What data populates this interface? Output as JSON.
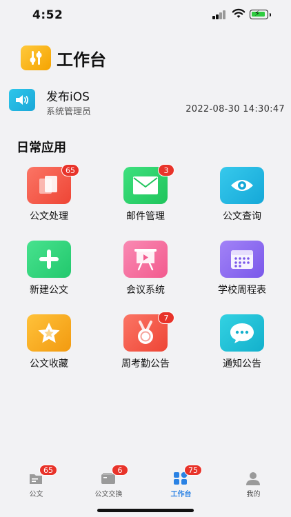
{
  "status_bar": {
    "time": "4:52"
  },
  "header": {
    "title": "工作台",
    "logo_icon": "sliders-icon"
  },
  "notice": {
    "icon": "speaker-icon",
    "title": "发布iOS",
    "sender": "系统管理员",
    "datetime": "2022-08-30 14:30:47"
  },
  "section": {
    "title": "日常应用"
  },
  "apps": [
    {
      "label": "公文处理",
      "icon": "documents-icon",
      "badge": "65",
      "color": "#f25a4a"
    },
    {
      "label": "邮件管理",
      "icon": "envelope-icon",
      "badge": "3",
      "color": "#2bd46a"
    },
    {
      "label": "公文查询",
      "icon": "eye-icon",
      "badge": "",
      "color": "#1fb5de"
    },
    {
      "label": "新建公文",
      "icon": "plus-icon",
      "badge": "",
      "color": "#2ed37a"
    },
    {
      "label": "会议系统",
      "icon": "presentation-icon",
      "badge": "",
      "color": "#f46a9c"
    },
    {
      "label": "学校周程表",
      "icon": "calendar-icon",
      "badge": "",
      "color": "#8a6cf0"
    },
    {
      "label": "公文收藏",
      "icon": "star-icon",
      "badge": "",
      "color": "#f5a81c"
    },
    {
      "label": "周考勤公告",
      "icon": "medal-icon",
      "badge": "7",
      "color": "#f25a4a"
    },
    {
      "label": "通知公告",
      "icon": "chat-bubble-icon",
      "badge": "",
      "color": "#1fc3d6"
    }
  ],
  "tabbar": [
    {
      "label": "公文",
      "icon": "folder-icon",
      "badge": "65",
      "active": false
    },
    {
      "label": "公文交换",
      "icon": "wallet-icon",
      "badge": "6",
      "active": false
    },
    {
      "label": "工作台",
      "icon": "grid-icon",
      "badge": "75",
      "active": true
    },
    {
      "label": "我的",
      "icon": "person-icon",
      "badge": "",
      "active": false
    }
  ],
  "colors": {
    "accent": "#2a82e4",
    "badge": "#e8332a",
    "background": "#f2f2f4"
  }
}
